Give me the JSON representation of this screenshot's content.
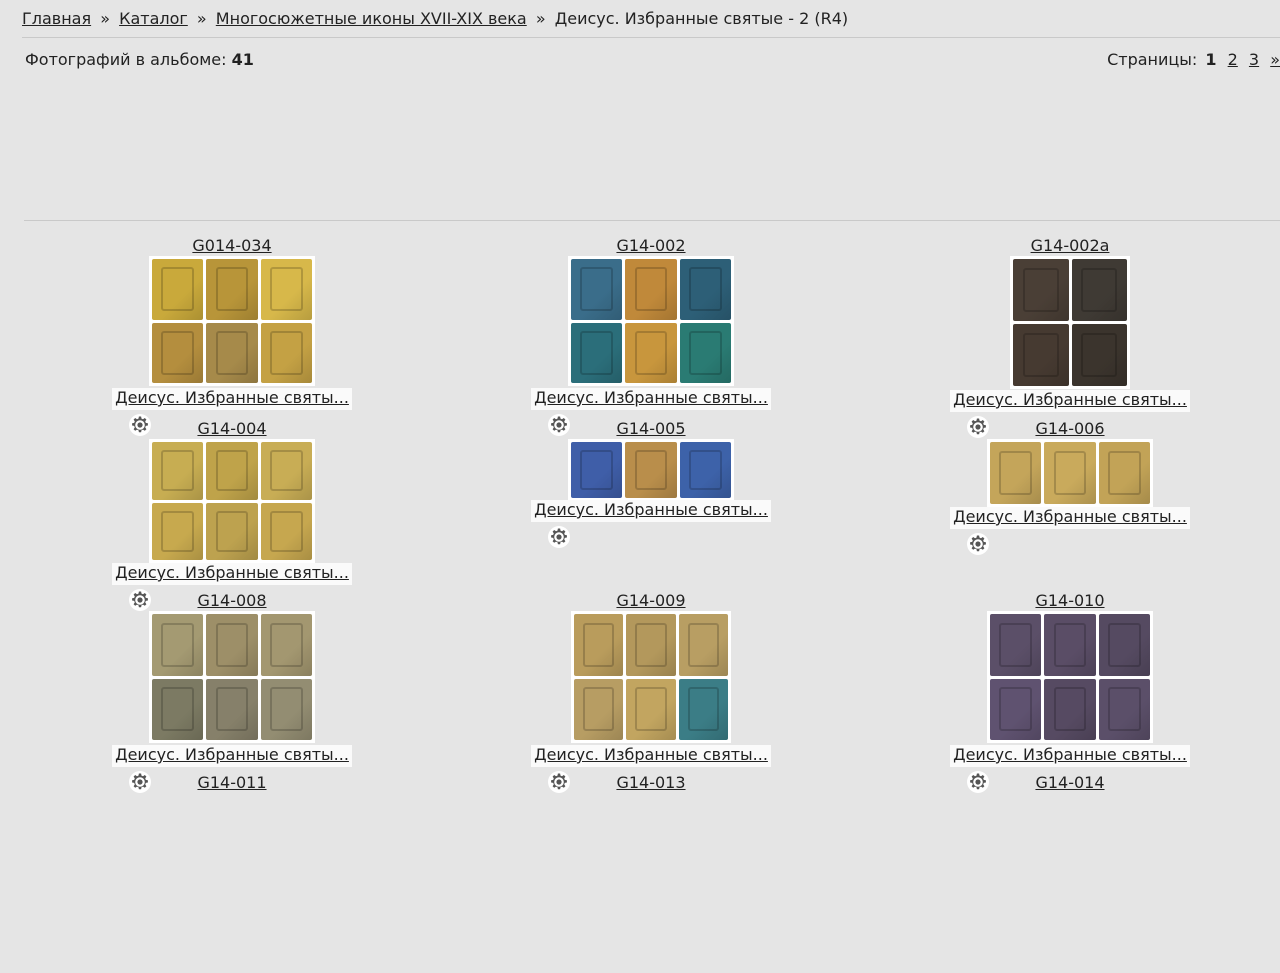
{
  "breadcrumb": {
    "home": "Главная",
    "catalog": "Каталог",
    "section": "Многосюжетные иконы XVII-XIX века",
    "current": "Деисус. Избранные святые - 2 (R4)",
    "sep": "»"
  },
  "album": {
    "count_label": "Фотографий в альбоме:",
    "count_value": "41"
  },
  "pager": {
    "label": "Страницы:",
    "current": "1",
    "pages": [
      "2",
      "3"
    ],
    "next": "»"
  },
  "items": [
    {
      "code": "G014-034",
      "title": "Деисус. Избранные святы...",
      "colors": [
        "#c9a93b",
        "#b89539",
        "#d7b84a",
        "#b48e3e",
        "#a68a4a",
        "#c4a144"
      ],
      "rows": 2,
      "cols": 3
    },
    {
      "code": "G14-002",
      "title": "Деисус. Избранные святы...",
      "colors": [
        "#3a6d8a",
        "#c0893a",
        "#2d5f77",
        "#2b6e7a",
        "#c8963d",
        "#2a7b73"
      ],
      "rows": 2,
      "cols": 3
    },
    {
      "code": "G14-002a",
      "title": "Деисус. Избранные святы...",
      "colors": [
        "#4a3f36",
        "#3f3a34",
        "#463a31",
        "#3b342d"
      ],
      "rows": 2,
      "cols": 2
    },
    {
      "code": "G14-004",
      "title": "Деисус. Избранные святы...",
      "colors": [
        "#c7ad52",
        "#bfa34a",
        "#c8ad55",
        "#c7a94e",
        "#bda24f",
        "#c6a74f"
      ],
      "rows": 2,
      "cols": 3
    },
    {
      "code": "G14-005",
      "title": "Деисус. Избранные святы...",
      "colors": [
        "#3f5ea8",
        "#b98e4b",
        "#3d62a9"
      ],
      "rows": 1,
      "cols": 3
    },
    {
      "code": "G14-006",
      "title": "Деисус. Избранные святы...",
      "colors": [
        "#c4a55a",
        "#c9aa5c",
        "#c2a357"
      ],
      "rows": 1,
      "cols": 3
    },
    {
      "code": "G14-008",
      "title": "Деисус. Избранные святы...",
      "colors": [
        "#a49a72",
        "#9d8f68",
        "#a39770",
        "#7c7a63",
        "#86806a",
        "#938d72"
      ],
      "rows": 2,
      "cols": 3
    },
    {
      "code": "G14-009",
      "title": "Деисус. Избранные святы...",
      "colors": [
        "#b99c5c",
        "#b3985c",
        "#b89e63",
        "#b79d63",
        "#c2a560",
        "#3b7d86"
      ],
      "rows": 2,
      "cols": 3
    },
    {
      "code": "G14-010",
      "title": "Деисус. Избранные святы...",
      "colors": [
        "#5b4f68",
        "#5a4d66",
        "#554a61",
        "#5f5270",
        "#564a62",
        "#5b4f69"
      ],
      "rows": 2,
      "cols": 3
    },
    {
      "code": "G14-011",
      "title": "",
      "colors": [],
      "rows": 0,
      "cols": 0
    },
    {
      "code": "G14-013",
      "title": "",
      "colors": [],
      "rows": 0,
      "cols": 0
    },
    {
      "code": "G14-014",
      "title": "",
      "colors": [],
      "rows": 0,
      "cols": 0
    }
  ]
}
